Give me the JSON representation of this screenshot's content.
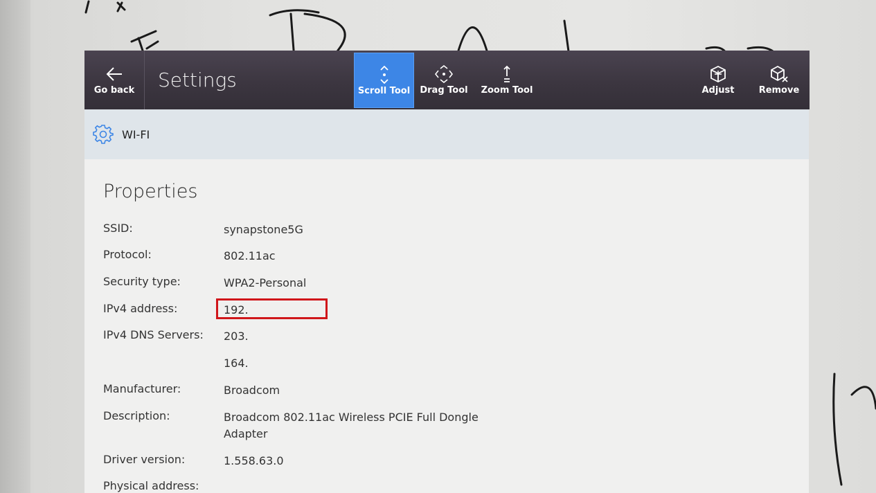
{
  "toolbar": {
    "go_back": "Go back",
    "title": "Settings",
    "scroll_tool": "Scroll Tool",
    "drag_tool": "Drag Tool",
    "zoom_tool": "Zoom Tool",
    "adjust": "Adjust",
    "remove": "Remove"
  },
  "section": {
    "title": "WI-FI"
  },
  "properties": {
    "heading": "Properties",
    "rows": [
      {
        "label": "SSID:",
        "value": "synapstone5G"
      },
      {
        "label": "Protocol:",
        "value": "802.11ac"
      },
      {
        "label": "Security type:",
        "value": "WPA2-Personal"
      },
      {
        "label": "IPv4 address:",
        "value": "192."
      },
      {
        "label": "IPv4 DNS Servers:",
        "value": "203."
      },
      {
        "label": "",
        "value": "164."
      },
      {
        "label": "Manufacturer:",
        "value": "Broadcom"
      },
      {
        "label": "Description:",
        "value": "Broadcom 802.11ac Wireless PCIE Full Dongle Adapter"
      },
      {
        "label": "Driver version:",
        "value": "1.558.63.0"
      },
      {
        "label": "Physical address:",
        "value": ""
      }
    ]
  },
  "colors": {
    "accent": "#3d86e6",
    "highlight": "#d0161a",
    "toolbar": "#3c3640"
  }
}
